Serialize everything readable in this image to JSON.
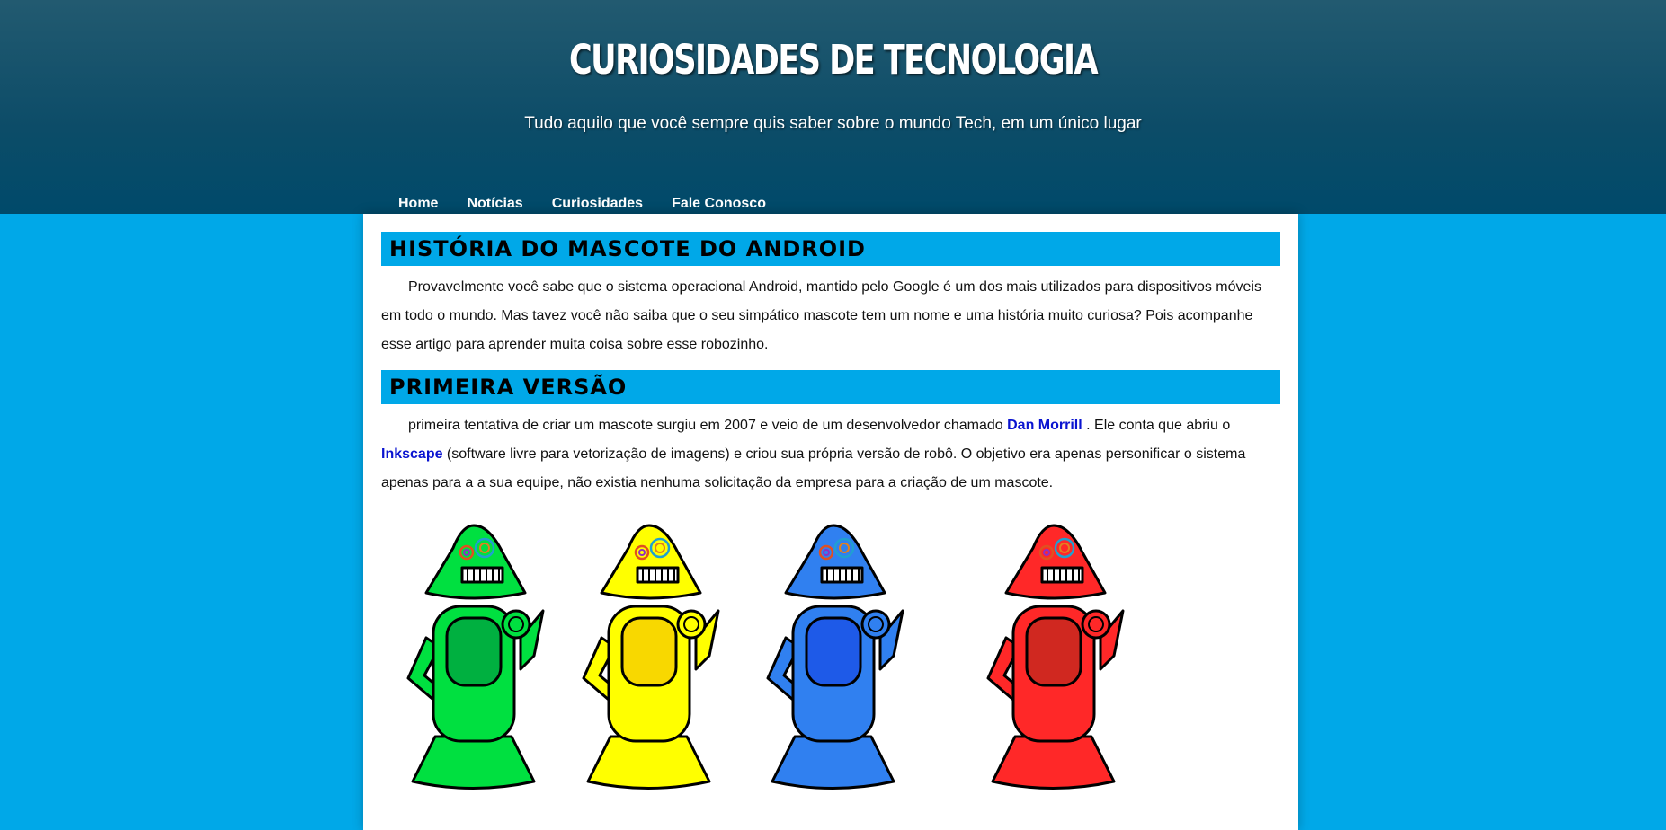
{
  "header": {
    "title": "CURIOSIDADES DE TECNOLOGIA",
    "subtitle": "Tudo aquilo que você sempre quis saber sobre o mundo Tech, em um único lugar"
  },
  "nav": {
    "items": [
      {
        "label": "Home"
      },
      {
        "label": "Notícias"
      },
      {
        "label": "Curiosidades"
      },
      {
        "label": "Fale Conosco"
      }
    ]
  },
  "article": {
    "section1": {
      "heading": "História do mascote do Android",
      "text": "Provavelmente você sabe que o sistema operacional Android, mantido pelo Google é um dos mais utilizados para dispositivos móveis em todo o mundo. Mas tavez você não saiba que o seu simpático mascote tem um nome e uma história muito curiosa? Pois acompanhe esse artigo para aprender muita coisa sobre esse robozinho."
    },
    "section2": {
      "heading": "Primeira Versão",
      "text_part1": "primeira tentativa de criar um mascote surgiu em 2007 e veio de um desenvolvedor chamado ",
      "link1": "Dan Morrill",
      "text_part2": " . Ele conta que abriu o ",
      "link2": "Inkscape",
      "text_part3": " (software livre para vetorização de imagens) e criou sua própria versão de robô. O objetivo era apenas personificar o sistema apenas para a a sua equipe, não existia nenhuma solicitação da empresa para a criação de um mascote."
    }
  },
  "image": {
    "robot_colors": [
      "#00e040",
      "#ffff00",
      "#3080f0",
      "#ff2828"
    ],
    "robot_panel_colors": [
      "#00b040",
      "#f8d800",
      "#1e5ae8",
      "#d02820"
    ]
  },
  "colors": {
    "page_bg": "#00a8e8",
    "header_bg": "#0c4c68",
    "heading_bg": "#00a8e8",
    "link": "#0a14d0"
  }
}
